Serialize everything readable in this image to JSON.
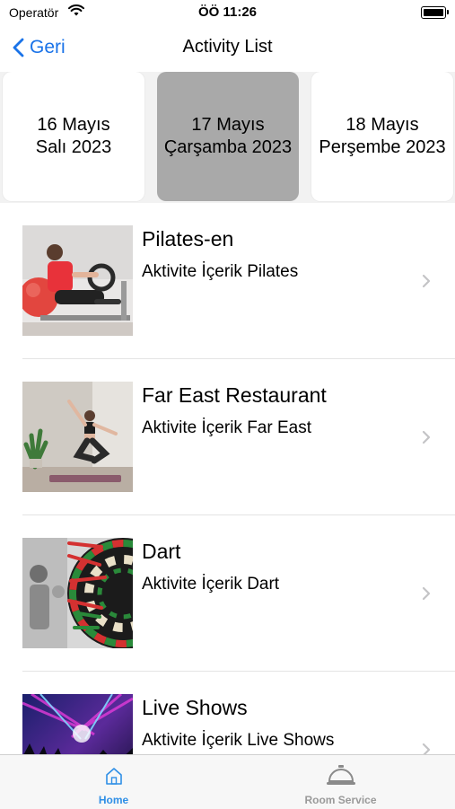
{
  "status_bar": {
    "carrier": "Operatör",
    "time": "ÖÖ 11:26"
  },
  "nav": {
    "back_label": "Geri",
    "title": "Activity List"
  },
  "dates": [
    {
      "line1": "16 Mayıs",
      "line2": "Salı 2023",
      "selected": false
    },
    {
      "line1": "17 Mayıs",
      "line2": "Çarşamba 2023",
      "selected": true
    },
    {
      "line1": "18 Mayıs",
      "line2": "Perşembe 2023",
      "selected": false
    }
  ],
  "activities": [
    {
      "title": "Pilates-en",
      "subtitle": "Aktivite İçerik Pilates",
      "image": "pilates-photo"
    },
    {
      "title": "Far East Restaurant",
      "subtitle": "Aktivite İçerik Far East",
      "image": "yoga-photo"
    },
    {
      "title": "Dart",
      "subtitle": "Aktivite İçerik Dart",
      "image": "dart-photo"
    },
    {
      "title": "Live Shows",
      "subtitle": "Aktivite İçerik Live Shows",
      "image": "concert-photo"
    }
  ],
  "tabs": [
    {
      "label": "Home",
      "icon": "home-icon",
      "active": true
    },
    {
      "label": "Room Service",
      "icon": "service-bell-icon",
      "active": false
    }
  ],
  "colors": {
    "accent": "#1a73e8",
    "tab_active": "#2f8fe6",
    "tab_inactive": "#9a9a9a",
    "selected_date": "#a9a9a9"
  }
}
